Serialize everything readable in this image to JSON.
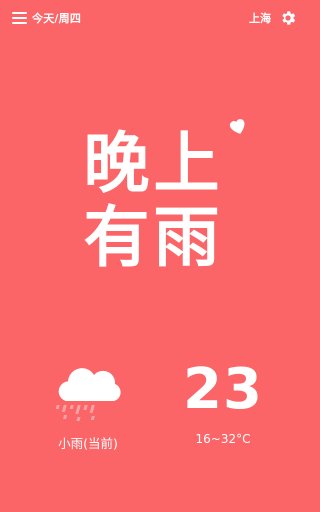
{
  "header": {
    "date_label": "今天/周四",
    "city": "上海"
  },
  "headline": {
    "line1": "晚上",
    "line2": "有雨"
  },
  "current": {
    "condition_label": "小雨(当前)",
    "temperature": "23",
    "range": "16~32°C"
  },
  "icons": {
    "menu": "menu-icon",
    "settings": "gear-icon",
    "heart": "heart-icon",
    "weather": "cloud-rain-icon"
  },
  "colors": {
    "background": "#FB6568",
    "foreground": "#FFFFFF",
    "rain": "#F7A3A5"
  }
}
